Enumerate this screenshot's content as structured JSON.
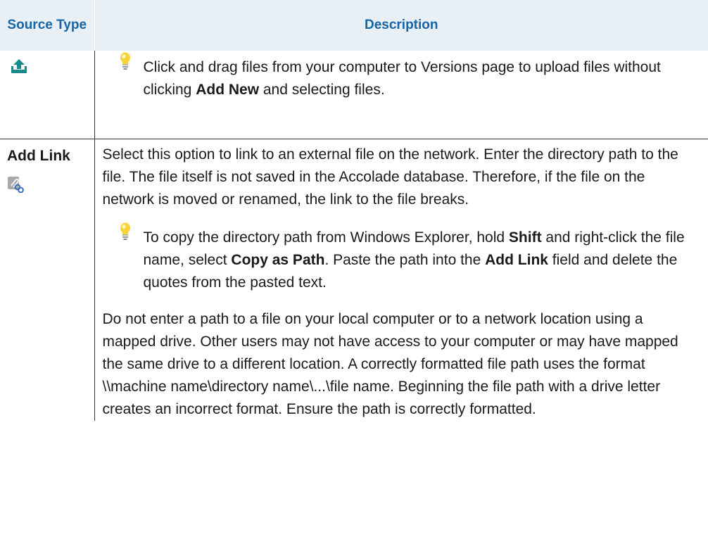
{
  "header": {
    "col_source": "Source Type",
    "col_description": "Description"
  },
  "rows": [
    {
      "icon": "upload-icon",
      "tip": {
        "icon": "lightbulb-icon",
        "t1": "Click and drag files from your computer to Versions page to upload files without clicking ",
        "b1": "Add New",
        "t2": " and selecting files."
      }
    },
    {
      "title": "Add Link",
      "icon": "paperclip-link-icon",
      "intro": "Select this option to link to an external file on the network. Enter the directory path to the file. The file itself is not saved in the Accolade database. Therefore, if the file on the network is moved or renamed, the link to the file breaks.",
      "tip": {
        "icon": "lightbulb-icon",
        "t1": "To copy the directory path from Windows Explorer, hold ",
        "b1": "Shift",
        "t2": " and right-click the file name, select ",
        "b2": "Copy as Path",
        "t3": ". Paste the path into the ",
        "b3": "Add Link",
        "t4": " field and delete the quotes from the pasted text."
      },
      "outro": "Do not enter a path to a file on your local computer or to a network location using a mapped drive. Other users may not have access to your computer or may have mapped the same drive to a different location. A correctly formatted file path uses the format \\\\machine name\\directory name\\...\\file name. Beginning the file path with a drive letter creates an incorrect format. Ensure the path is correctly formatted."
    }
  ],
  "colors": {
    "header_bg": "#e8eff5",
    "header_text": "#1565a8",
    "icon_teal": "#1b8a8c",
    "bulb_yellow": "#f7d33a"
  }
}
